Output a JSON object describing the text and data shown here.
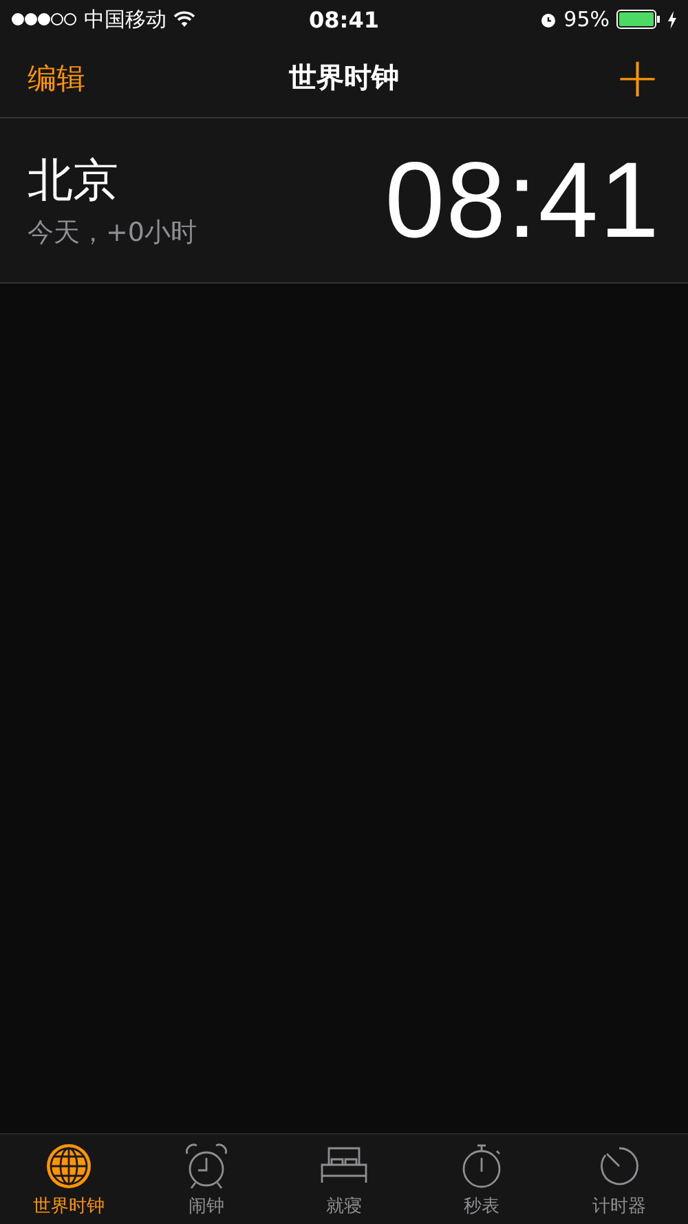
{
  "status_bar": {
    "carrier": "中国移动",
    "time": "08:41",
    "battery": "95%"
  },
  "nav": {
    "left": "编辑",
    "title": "世界时钟",
    "right": "+"
  },
  "clocks": [
    {
      "city": "北京",
      "offset": "今天，+0小时",
      "time": "08:41"
    }
  ],
  "tabs": [
    {
      "label": "世界时钟",
      "selected": true
    },
    {
      "label": "闹钟",
      "selected": false
    },
    {
      "label": "就寝",
      "selected": false
    },
    {
      "label": "秒表",
      "selected": false
    },
    {
      "label": "计时器",
      "selected": false
    }
  ]
}
